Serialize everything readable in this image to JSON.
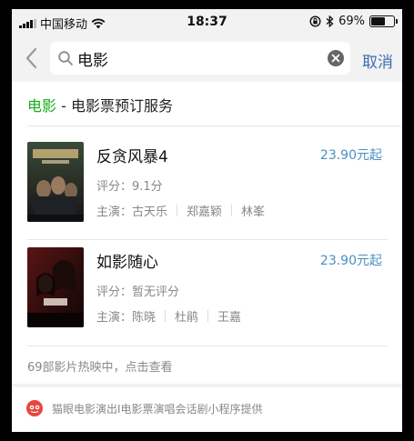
{
  "status_bar": {
    "carrier": "中国移动",
    "time": "18:37",
    "battery": "69%",
    "battery_level": 0.69
  },
  "search": {
    "query": "电影",
    "cancel_label": "取消"
  },
  "section": {
    "accent": "电影",
    "rest": " - 电影票预订服务"
  },
  "movies": [
    {
      "title": "反贪风暴4",
      "price": "23.90元起",
      "rating": "评分：9.1分",
      "cast_label": "主演：",
      "cast": [
        "古天乐",
        "郑嘉颖",
        "林峯"
      ]
    },
    {
      "title": "如影随心",
      "price": "23.90元起",
      "rating": "评分：暂无评分",
      "cast_label": "主演：",
      "cast": [
        "陈晓",
        "杜鹃",
        "王嘉"
      ]
    }
  ],
  "more_text": "69部影片热映中，点击查看",
  "footer_text": "猫眼电影演出I电影票演唱会话剧小程序提供",
  "colors": {
    "accent_green": "#1aad19",
    "link_blue": "#3c6fb0",
    "price_blue": "#4a90c2",
    "logo_red": "#e8453c"
  }
}
